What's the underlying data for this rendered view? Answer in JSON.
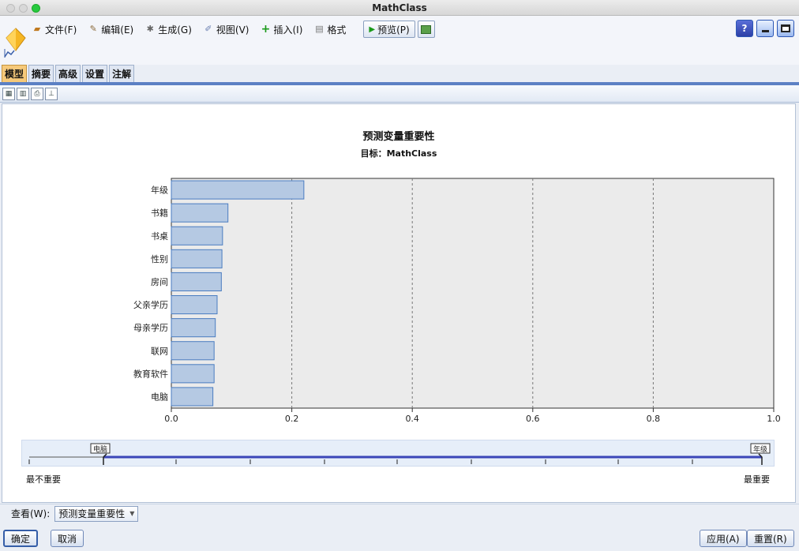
{
  "window": {
    "title": "MathClass"
  },
  "menu": [
    {
      "label": "文件(F)",
      "icon": "folder-icon"
    },
    {
      "label": "编辑(E)",
      "icon": "edit-icon"
    },
    {
      "label": "生成(G)",
      "icon": "generate-icon"
    },
    {
      "label": "视图(V)",
      "icon": "view-icon"
    },
    {
      "label": "插入(I)",
      "icon": "plus-icon"
    },
    {
      "label": "格式",
      "icon": "document-icon"
    }
  ],
  "preview_label": "预览(P)",
  "tabs": [
    "模型",
    "摘要",
    "高级",
    "设置",
    "注解"
  ],
  "active_tab": "模型",
  "chart_data": {
    "type": "bar",
    "orientation": "horizontal",
    "title": "预测变量重要性",
    "subtitle": "目标：MathClass",
    "categories": [
      "年级",
      "书籍",
      "书桌",
      "性别",
      "房间",
      "父亲学历",
      "母亲学历",
      "联网",
      "教育软件",
      "电脑"
    ],
    "values": [
      0.22,
      0.094,
      0.085,
      0.084,
      0.083,
      0.076,
      0.073,
      0.071,
      0.071,
      0.069
    ],
    "xlim": [
      0.0,
      1.0
    ],
    "xticks": [
      "0.0",
      "0.2",
      "0.4",
      "0.6",
      "0.8",
      "1.0"
    ],
    "grid": "vertical-dashed",
    "bar_color": "#b5c9e3",
    "bar_border_color": "#4a7cc0",
    "plot_background": "#ebebeb"
  },
  "slider": {
    "min_tag": "电脑",
    "max_tag": "年级",
    "left_label": "最不重要",
    "right_label": "最重要",
    "track_color": "#3b46b8"
  },
  "view": {
    "label": "查看(W):",
    "selected": "预测变量重要性"
  },
  "buttons": {
    "ok": "确定",
    "cancel": "取消",
    "apply": "应用(A)",
    "reset": "重置(R)"
  }
}
